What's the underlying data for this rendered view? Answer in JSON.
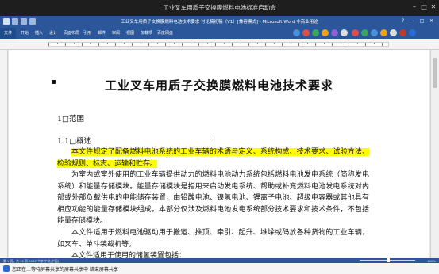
{
  "outer": {
    "title": "工业叉车用质子交换膜燃料电池标准启动会"
  },
  "word": {
    "doc_title": "工业叉车用质子交换膜燃料电池技术要求 讨论稿初稿（V1）[兼容模式] - Microsoft Word 非商业用途",
    "ribbon_tabs": [
      "文件",
      "开始",
      "插入",
      "设计",
      "页面布局",
      "引用",
      "邮件",
      "审阅",
      "视图",
      "加载项",
      "百度网盘"
    ]
  },
  "document": {
    "title": "工业叉车用质子交换膜燃料电池技术要求",
    "section_1": "1□范围",
    "section_1_1": "1.1□概述",
    "para1": "本文件规定了配备燃料电池系统的工业车辆的术语与定义、系统构成、技术要求、试验方法、检验规则、标志、运输和贮存。",
    "para2": "为室内或室外使用的工业车辆提供动力的燃料电池动力系统包括燃料电池发电系统（简称发电系统）和能量存储模块。能量存储模块是指用来启动发电系统、帮助或补充燃料电池发电系统对内部或外部负载供电的电能储存装置，由铅酸电池、镍氢电池、锂离子电池、超级电容器或其他具有相应功能的能量存储模块组成。本部分仅涉及燃料电池发电系统部分技术要求和技术条件，不包括能量存储模块。",
    "para3": "本文件适用于燃料电池驱动用于搬运、推顶、牵引、起升、堆垛或码放各种货物的工业车辆，如叉车、单斗装载机等。",
    "para4": "本文件适用于使用的储氢装置包括："
  },
  "status": {
    "left": "第 1 页，共 21 页    5967 个字    中文(中国)",
    "zoom": "100%"
  },
  "taskbar": {
    "share_text": "您正在…等待屏幕共享的屏幕共享中  结束屏幕共享"
  },
  "colors": {
    "word_blue": "#2b579a",
    "highlight": "#ffff00"
  }
}
